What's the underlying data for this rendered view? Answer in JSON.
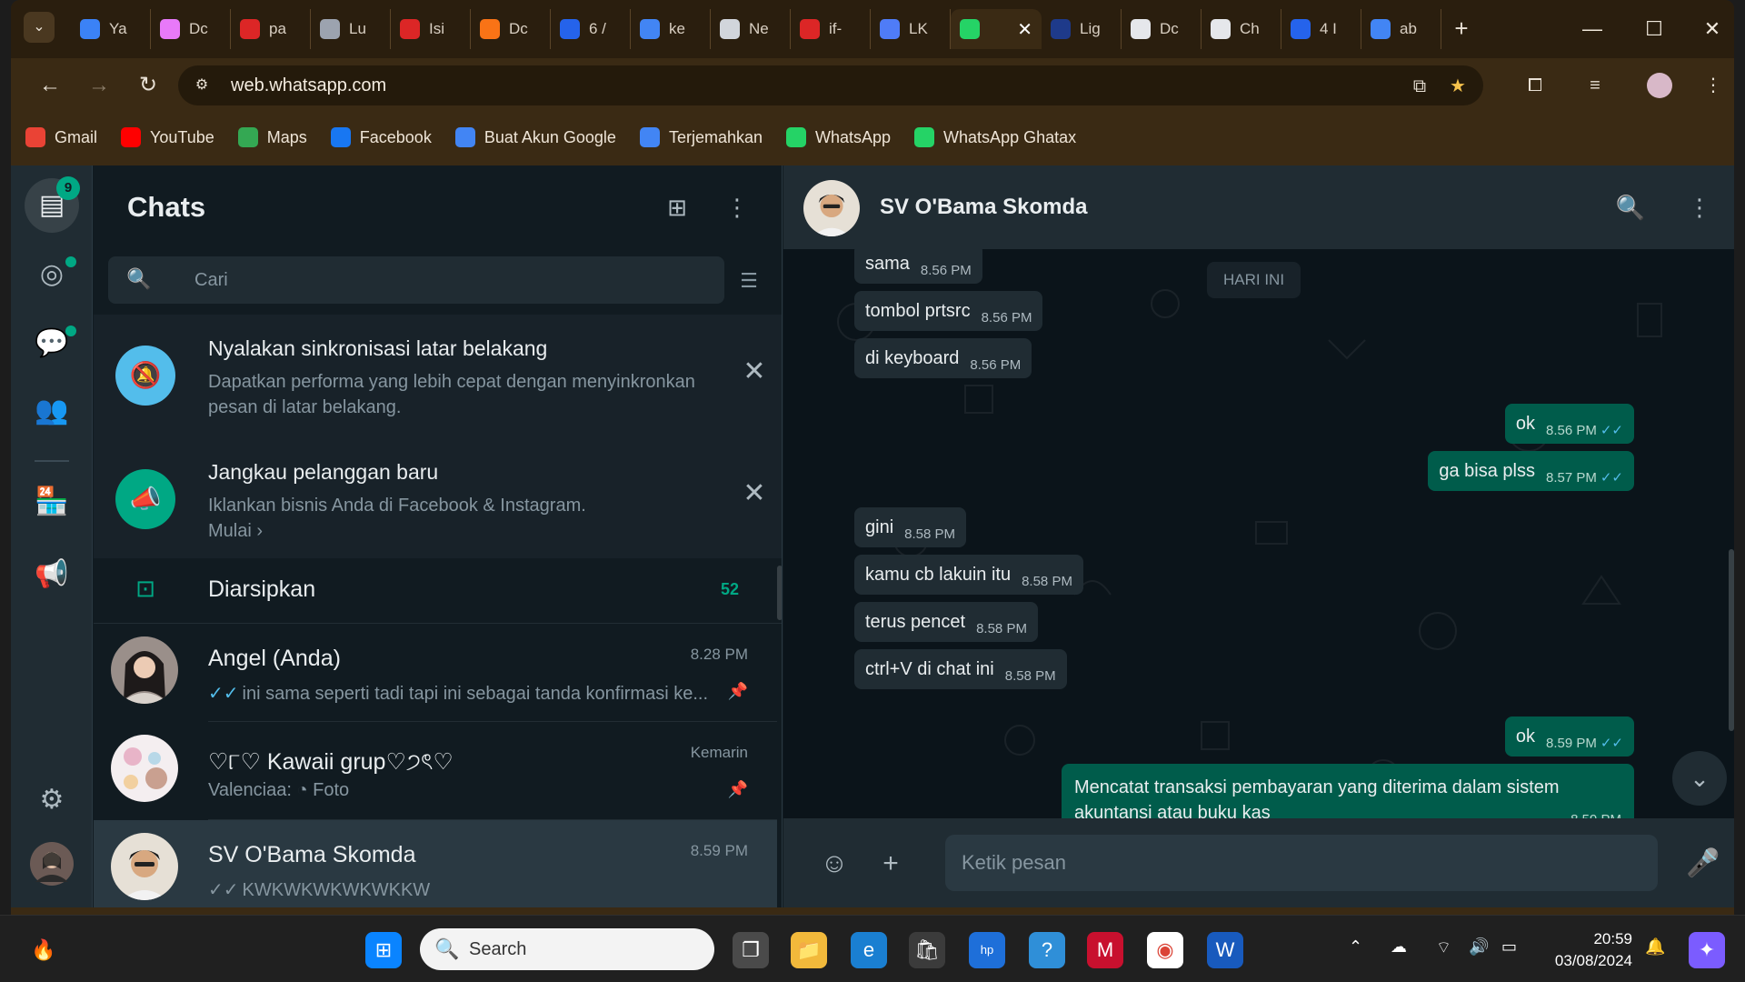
{
  "browser": {
    "tabs": [
      {
        "label": "Ya",
        "color": "#3b82f6"
      },
      {
        "label": "Dc",
        "color": "#e879f9"
      },
      {
        "label": "pa",
        "color": "#dc2626"
      },
      {
        "label": "Lu",
        "color": "#9ca3af"
      },
      {
        "label": "Isi",
        "color": "#dc2626"
      },
      {
        "label": "Dc",
        "color": "#f97316"
      },
      {
        "label": "6 /",
        "color": "#2563eb"
      },
      {
        "label": "ke",
        "color": "#4285f4"
      },
      {
        "label": "Ne",
        "color": "#d1d5db"
      },
      {
        "label": "if-",
        "color": "#dc2626"
      },
      {
        "label": "LK",
        "color": "#4f7cf7"
      },
      {
        "label": "",
        "color": "#25d366",
        "active": true
      },
      {
        "label": "Lig",
        "color": "#1e3a8a"
      },
      {
        "label": "Dc",
        "color": "#e5e7eb"
      },
      {
        "label": "Ch",
        "color": "#e5e7eb"
      },
      {
        "label": "4 I",
        "color": "#2563eb"
      },
      {
        "label": "ab",
        "color": "#4285f4"
      }
    ],
    "url": "web.whatsapp.com",
    "bookmarks": [
      {
        "label": "Gmail",
        "color": "#ea4335"
      },
      {
        "label": "YouTube",
        "color": "#ff0000"
      },
      {
        "label": "Maps",
        "color": "#34a853"
      },
      {
        "label": "Facebook",
        "color": "#1877f2"
      },
      {
        "label": "Buat Akun Google",
        "color": "#4285f4"
      },
      {
        "label": "Terjemahkan",
        "color": "#4285f4"
      },
      {
        "label": "WhatsApp",
        "color": "#25d366"
      },
      {
        "label": "WhatsApp Ghatax",
        "color": "#25d366"
      }
    ]
  },
  "rail": {
    "chats_badge": "9"
  },
  "chatlist": {
    "title": "Chats",
    "search_placeholder": "Cari",
    "notices": [
      {
        "title": "Nyalakan sinkronisasi latar belakang",
        "text": "Dapatkan performa yang lebih cepat dengan menyinkronkan pesan di latar belakang.",
        "color": "#53bdeb"
      },
      {
        "title": "Jangkau pelanggan baru",
        "text": "Iklankan bisnis Anda di Facebook & Instagram.",
        "link": "Mulai",
        "color": "#00a884"
      }
    ],
    "archived": {
      "label": "Diarsipkan",
      "count": "52"
    },
    "chats": [
      {
        "name": "Angel (Anda)",
        "time": "8.28 PM",
        "message": "ini sama seperti tadi tapi ini sebagai tanda konfirmasi ke...",
        "ticks": "✓✓",
        "pinned": true
      },
      {
        "name": "♡୮♡ Kawaii grup♡੭ৎ♡",
        "time": "Kemarin",
        "sender": "Valenciaa:",
        "message": "Foto",
        "pinned": true
      },
      {
        "name": "SV O'Bama Skomda",
        "time": "8.59 PM",
        "message": "KWKWKWKWKWKKW",
        "ticks": "✓✓",
        "selected": true
      }
    ]
  },
  "conversation": {
    "name": "SV O'Bama Skomda",
    "day_label": "HARI INI",
    "composer_placeholder": "Ketik pesan",
    "messages": [
      {
        "dir": "in",
        "text": "sama",
        "time": "8.56 PM"
      },
      {
        "dir": "in",
        "text": "tombol prtsrc",
        "time": "8.56 PM"
      },
      {
        "dir": "in",
        "text": "di keyboard",
        "time": "8.56 PM"
      },
      {
        "dir": "out",
        "text": "ok",
        "time": "8.56 PM"
      },
      {
        "dir": "out",
        "text": "ga bisa plss",
        "time": "8.57 PM"
      },
      {
        "dir": "in",
        "text": "gini",
        "time": "8.58 PM"
      },
      {
        "dir": "in",
        "text": "kamu cb lakuin itu",
        "time": "8.58 PM"
      },
      {
        "dir": "in",
        "text": "terus pencet",
        "time": "8.58 PM"
      },
      {
        "dir": "in",
        "text": "ctrl+V di chat ini",
        "time": "8.58 PM"
      },
      {
        "dir": "out",
        "text": "ok",
        "time": "8.59 PM"
      },
      {
        "dir": "out",
        "text": "Mencatat transaksi pembayaran yang diterima dalam sistem akuntansi atau buku kas",
        "time": "8.59 PM"
      }
    ]
  },
  "taskbar": {
    "search_label": "Search",
    "time": "20:59",
    "date": "03/08/2024"
  }
}
